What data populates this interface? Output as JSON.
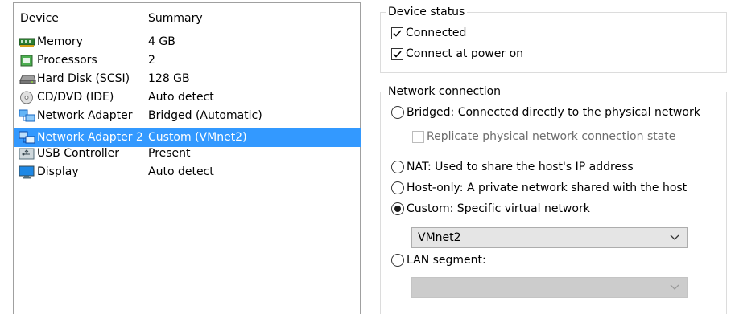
{
  "device_list": {
    "headers": {
      "device": "Device",
      "summary": "Summary"
    },
    "rows": [
      {
        "name": "Memory",
        "summary": "4 GB",
        "icon": "memory-icon"
      },
      {
        "name": "Processors",
        "summary": "2",
        "icon": "processor-icon"
      },
      {
        "name": "Hard Disk (SCSI)",
        "summary": "128 GB",
        "icon": "hard-disk-icon"
      },
      {
        "name": "CD/DVD (IDE)",
        "summary": "Auto detect",
        "icon": "cd-dvd-icon"
      },
      {
        "name": "Network Adapter",
        "summary": "Bridged (Automatic)",
        "icon": "network-adapter-icon"
      },
      {
        "name": "Network Adapter 2",
        "summary": "Custom (VMnet2)",
        "icon": "network-adapter-icon",
        "selected": true
      },
      {
        "name": "USB Controller",
        "summary": "Present",
        "icon": "usb-icon"
      },
      {
        "name": "Display",
        "summary": "Auto detect",
        "icon": "display-icon"
      }
    ]
  },
  "device_status": {
    "legend": "Device status",
    "connected": {
      "label": "Connected",
      "checked": true
    },
    "connect_at_power_on": {
      "label": "Connect at power on",
      "checked": true
    }
  },
  "network_connection": {
    "legend": "Network connection",
    "bridged": {
      "label": "Bridged: Connected directly to the physical network",
      "selected": false
    },
    "replicate": {
      "label": "Replicate physical network connection state",
      "checked": false,
      "disabled": true
    },
    "nat": {
      "label": "NAT: Used to share the host's IP address",
      "selected": false
    },
    "host_only": {
      "label": "Host-only: A private network shared with the host",
      "selected": false
    },
    "custom": {
      "label": "Custom: Specific virtual network",
      "selected": true
    },
    "custom_network_value": "VMnet2",
    "lan_segment": {
      "label": "LAN segment:",
      "selected": false
    },
    "lan_segment_value": ""
  },
  "colors": {
    "selection": "#3399ff",
    "group_border": "#dcdcdc"
  }
}
